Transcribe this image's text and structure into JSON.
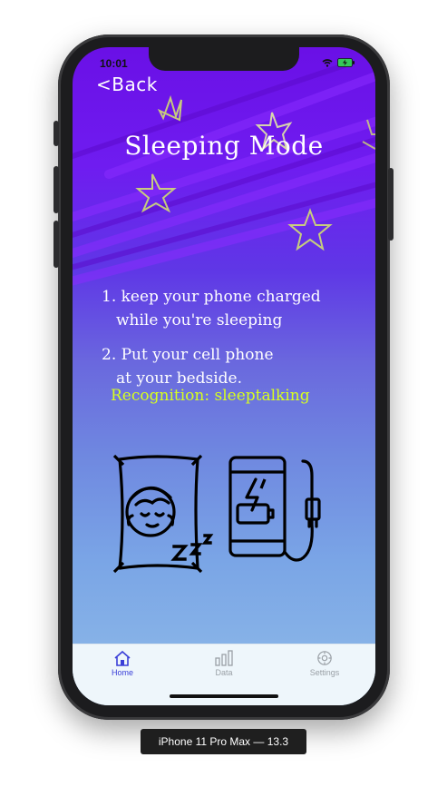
{
  "status_bar": {
    "time": "10:01"
  },
  "nav": {
    "back_label": "<Back"
  },
  "page": {
    "title": "Sleeping Mode",
    "instructions": [
      {
        "line1": "1. keep your phone charged",
        "line2": "while you're sleeping"
      },
      {
        "line1": "2. Put your cell phone",
        "line2": "at your bedside."
      }
    ],
    "recognition_label": "Recognition: sleeptalking"
  },
  "tabbar": {
    "items": [
      {
        "label": "Home",
        "icon": "home-icon",
        "active": true
      },
      {
        "label": "Data",
        "icon": "bar-chart-icon",
        "active": false
      },
      {
        "label": "Settings",
        "icon": "gear-icon",
        "active": false
      }
    ]
  },
  "device_label": "iPhone 11 Pro Max — 13.3",
  "colors": {
    "accent": "#3a3fd8",
    "recognition": "#d8ff1e",
    "background_top": "#6a10e6",
    "background_bottom": "#8fbbe8"
  }
}
